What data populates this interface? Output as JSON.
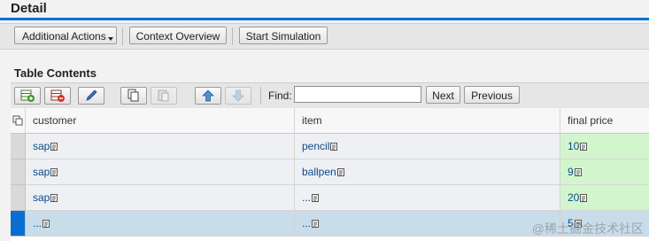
{
  "page": {
    "title": "Detail"
  },
  "toolbar": {
    "additional_actions": "Additional Actions",
    "context_overview": "Context Overview",
    "start_simulation": "Start Simulation"
  },
  "table_section": {
    "title": "Table Contents"
  },
  "table_toolbar": {
    "icons": [
      "insert-row-icon",
      "delete-row-icon",
      "edit-icon",
      "copy-icon",
      "paste-icon",
      "move-up-icon",
      "move-down-icon"
    ],
    "find_label": "Find:",
    "find_value": "",
    "next": "Next",
    "previous": "Previous"
  },
  "table": {
    "columns": [
      "customer",
      "item",
      "final price"
    ],
    "rows": [
      {
        "customer": "sap",
        "item": "pencil",
        "final_price": "10"
      },
      {
        "customer": "sap",
        "item": "ballpen",
        "final_price": "9"
      },
      {
        "customer": "sap",
        "item": "...",
        "final_price": "20"
      },
      {
        "customer": "...",
        "item": "...",
        "final_price": "5"
      }
    ],
    "selected_row": 3
  },
  "colors": {
    "accent": "#0a6ed1",
    "row_alt": "#eef0f4",
    "row_selected": "#c8dde9",
    "price_cell": "#d3f5cd",
    "link": "#0a4a8a"
  },
  "watermark": "@稀土掘金技术社区"
}
